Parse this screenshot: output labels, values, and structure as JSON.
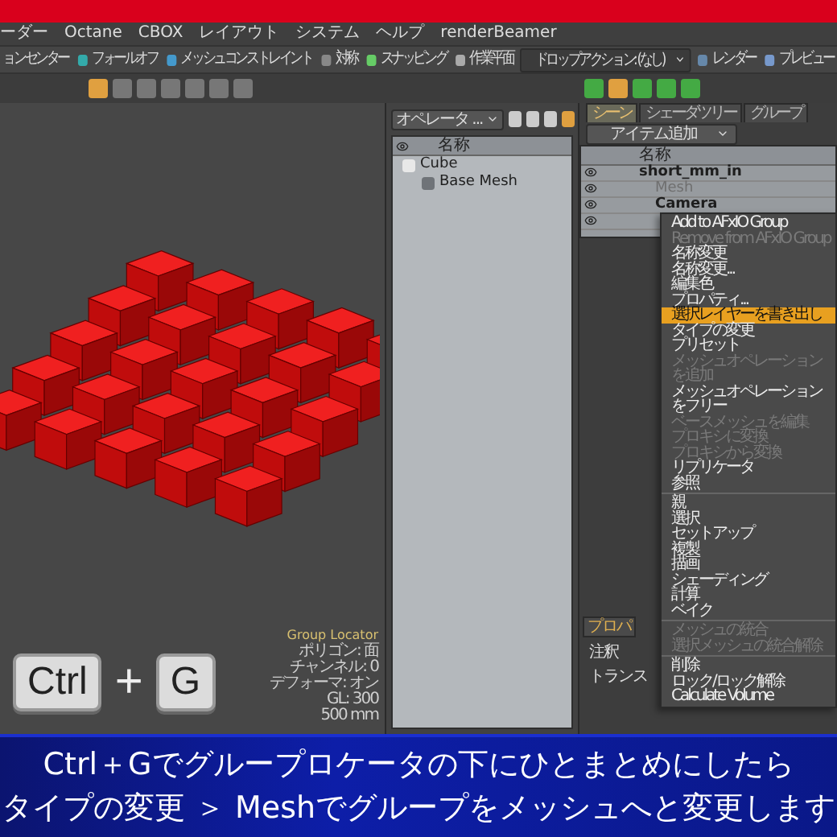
{
  "menu_bar": [
    "ーダー",
    "Octane",
    "CBOX",
    "レイアウト",
    "システム",
    "ヘルプ",
    "renderBeamer"
  ],
  "toolbar": [
    {
      "kind": "button",
      "label": "ョンセンター"
    },
    {
      "kind": "button",
      "label": "フォールオフ"
    },
    {
      "kind": "button",
      "label": "メッシュコンストレイント"
    },
    {
      "kind": "button",
      "label": "対称"
    },
    {
      "kind": "button",
      "label": "スナッピング"
    },
    {
      "kind": "button",
      "label": "作業平面"
    },
    {
      "kind": "dropdown",
      "label": "ドロップアクション: (なし)"
    },
    {
      "kind": "button",
      "label": "レンダー"
    },
    {
      "kind": "button",
      "label": "プレビュー"
    }
  ],
  "viewport": {
    "info": [
      "Group Locator",
      "ポリゴン: 面",
      "チャンネル: 0",
      "デフォーマ: オン",
      "GL: 300",
      "500 mm"
    ],
    "keys": [
      {
        "kind": "key",
        "label": "Ctrl"
      },
      {
        "kind": "plus",
        "label": "+"
      },
      {
        "kind": "key",
        "label": "G"
      }
    ]
  },
  "operator_panel": {
    "dropdown": "オペレータ ...",
    "column": "名称",
    "tree": [
      {
        "label": "Cube",
        "children": [
          {
            "label": "Base Mesh"
          }
        ]
      }
    ]
  },
  "scene_panel": {
    "tabs": [
      {
        "label": "シーン",
        "selected": true
      },
      {
        "label": "シェーダツリー",
        "selected": false
      },
      {
        "label": "グループ",
        "selected": false
      }
    ],
    "add_item": "アイテム追加",
    "column": "名称",
    "tree": [
      {
        "label": "short_mm_in",
        "disabled": false,
        "children": [
          {
            "label": "Mesh",
            "disabled": true
          },
          {
            "label": "Camera",
            "disabled": false
          }
        ]
      }
    ]
  },
  "properties_panel": {
    "tab": "プロパ",
    "rows": [
      "注釈",
      "トランス"
    ]
  },
  "context_menu": [
    {
      "kind": "item",
      "label": "Add to AFxIO Group",
      "disabled": false,
      "selected": false
    },
    {
      "kind": "item",
      "label": "Remove from AFxIO Group",
      "disabled": true,
      "selected": false
    },
    {
      "kind": "item",
      "label": "名称変更",
      "disabled": false,
      "selected": false
    },
    {
      "kind": "item",
      "label": "名称変更...",
      "disabled": false,
      "selected": false
    },
    {
      "kind": "item",
      "label": "編集色",
      "disabled": false,
      "selected": false
    },
    {
      "kind": "item",
      "label": "プロパティ...",
      "disabled": false,
      "selected": false
    },
    {
      "kind": "item",
      "label": "選択レイヤーを書き出し",
      "disabled": false,
      "selected": true
    },
    {
      "kind": "item",
      "label": "タイプの変更",
      "disabled": false,
      "selected": false
    },
    {
      "kind": "item",
      "label": "プリセット",
      "disabled": false,
      "selected": false
    },
    {
      "kind": "item",
      "label": "メッシュオペレーションを追加",
      "disabled": true,
      "selected": false
    },
    {
      "kind": "item",
      "label": "メッシュオペレーションをフリー",
      "disabled": false,
      "selected": false
    },
    {
      "kind": "item",
      "label": "ベースメッシュを編集",
      "disabled": true,
      "selected": false
    },
    {
      "kind": "item",
      "label": "プロキシに変換",
      "disabled": true,
      "selected": false
    },
    {
      "kind": "item",
      "label": "プロキシから変換",
      "disabled": true,
      "selected": false
    },
    {
      "kind": "item",
      "label": "リプリケータ",
      "disabled": false,
      "selected": false
    },
    {
      "kind": "item",
      "label": "参照",
      "disabled": false,
      "selected": false
    },
    {
      "kind": "separator"
    },
    {
      "kind": "item",
      "label": "親",
      "disabled": false,
      "selected": false
    },
    {
      "kind": "item",
      "label": "選択",
      "disabled": false,
      "selected": false
    },
    {
      "kind": "item",
      "label": "セットアップ",
      "disabled": false,
      "selected": false
    },
    {
      "kind": "item",
      "label": "複製",
      "disabled": false,
      "selected": false
    },
    {
      "kind": "item",
      "label": "描画",
      "disabled": false,
      "selected": false
    },
    {
      "kind": "item",
      "label": "シェーディング",
      "disabled": false,
      "selected": false
    },
    {
      "kind": "item",
      "label": "計算",
      "disabled": false,
      "selected": false
    },
    {
      "kind": "item",
      "label": "ベイク",
      "disabled": false,
      "selected": false
    },
    {
      "kind": "separator"
    },
    {
      "kind": "item",
      "label": "メッシュの統合",
      "disabled": true,
      "selected": false
    },
    {
      "kind": "item",
      "label": "選択メッシュの統合解除",
      "disabled": true,
      "selected": false
    },
    {
      "kind": "separator"
    },
    {
      "kind": "item",
      "label": "削除",
      "disabled": false,
      "selected": false
    },
    {
      "kind": "item",
      "label": "ロック/ロック解除",
      "disabled": false,
      "selected": false
    },
    {
      "kind": "item",
      "label": "Calculate Volume",
      "disabled": false,
      "selected": false
    }
  ],
  "subtitle": [
    "Ctrl＋Gでグループロケータの下にひとまとめにしたら",
    "タイプの変更 ＞ Meshでグループをメッシュへと変更します"
  ]
}
